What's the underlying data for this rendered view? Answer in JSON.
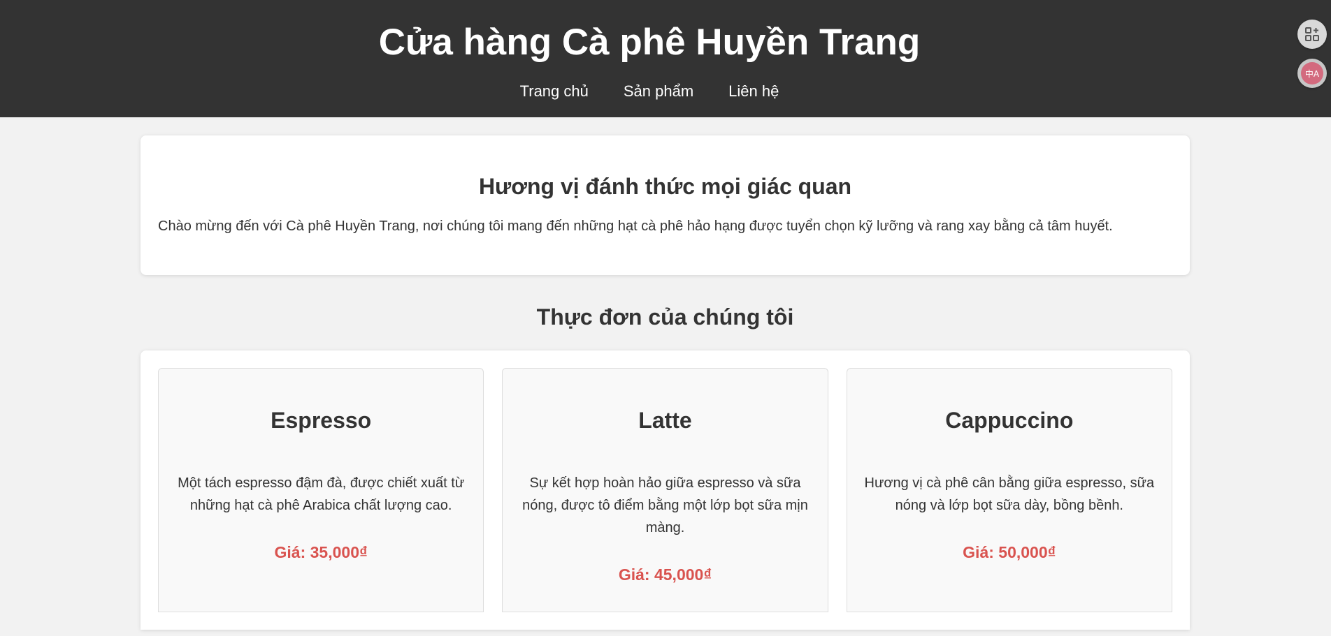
{
  "header": {
    "title": "Cửa hàng Cà phê Huyền Trang",
    "nav": [
      "Trang chủ",
      "Sản phẩm",
      "Liên hệ"
    ]
  },
  "intro": {
    "heading": "Hương vị đánh thức mọi giác quan",
    "text": "Chào mừng đến với Cà phê Huyền Trang, nơi chúng tôi mang đến những hạt cà phê hảo hạng được tuyển chọn kỹ lưỡng và rang xay bằng cả tâm huyết."
  },
  "menu": {
    "title": "Thực đơn của chúng tôi",
    "items": [
      {
        "name": "Espresso",
        "description": "Một tách espresso đậm đà, được chiết xuất từ những hạt cà phê Arabica chất lượng cao.",
        "price": "Giá: 35,000₫"
      },
      {
        "name": "Latte",
        "description": "Sự kết hợp hoàn hảo giữa espresso và sữa nóng, được tô điểm bằng một lớp bọt sữa mịn màng.",
        "price": "Giá: 45,000₫"
      },
      {
        "name": "Cappuccino",
        "description": "Hương vị cà phê cân bằng giữa espresso, sữa nóng và lớp bọt sữa dày, bồng bềnh.",
        "price": "Giá: 50,000₫"
      }
    ]
  },
  "side_tools": {
    "apps_icon": "apps-add-icon",
    "translate_icon": "translate-icon",
    "translate_glyph": "中A"
  },
  "colors": {
    "header_bg": "#333333",
    "price": "#d9534f",
    "page_bg": "#f2f2f2"
  }
}
